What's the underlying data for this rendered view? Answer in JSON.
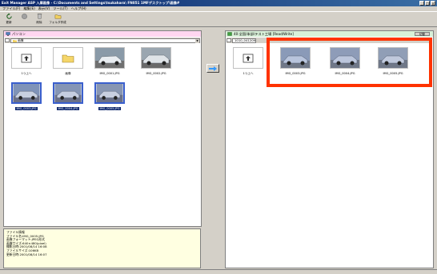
{
  "window": {
    "title": "Exit Manager ASP  入庫画像 - C:\\Documents and Settings\\tsukahara\\ FN051 1MFデスクトップ\\画像#",
    "controls": [
      "_",
      "□",
      "×"
    ]
  },
  "menu": [
    "ファイル(F)",
    "編集(E)",
    "表示(V)",
    "ツール(T)",
    "ヘルプ(H)"
  ],
  "toolbar": [
    {
      "label": "更新",
      "icon": "refresh-icon"
    },
    {
      "label": "",
      "icon": "stop-icon"
    },
    {
      "label": "削除",
      "icon": "delete-icon"
    },
    {
      "label": "フォルダ作成",
      "icon": "new-folder-icon"
    }
  ],
  "left_pane": {
    "header": "パソコン",
    "path": "画像",
    "items": [
      {
        "caption": "1つ上へ",
        "type": "up"
      },
      {
        "caption": "画像",
        "type": "folder"
      },
      {
        "caption": "IMG_0001.JPG",
        "type": "photo"
      },
      {
        "caption": "IMG_0002.JPG",
        "type": "photo"
      },
      {
        "caption": "IMG_0003.JPG",
        "type": "photo",
        "selected": true
      },
      {
        "caption": "IMG_0004.JPG",
        "type": "photo",
        "selected": true
      },
      {
        "caption": "IMG_0005.JPG",
        "type": "photo",
        "selected": true
      }
    ]
  },
  "right_pane": {
    "header": "40:全国/本部/テスト工場 [Read/Write]",
    "switch_label": "切替",
    "path": "1010_041209",
    "items": [
      {
        "caption": "1つ上へ",
        "type": "up"
      },
      {
        "caption": "IMG_0003.JPG",
        "type": "photo"
      },
      {
        "caption": "IMG_0004.JPG",
        "type": "photo"
      },
      {
        "caption": "IMG_0005.JPG",
        "type": "photo"
      }
    ]
  },
  "info": {
    "lines": [
      "ファイル情報",
      "ファイル名:IMG_0005.JPG",
      "画像フォーマット:JPEG形式",
      "画像サイズ:640×480(pixel)",
      "撮影日時:2001/08/14 16:08",
      "ファイルサイズ:106KB",
      "更新日時:2001/08/14 16:07"
    ]
  },
  "colors": {
    "title_start": "#0a246a",
    "title_end": "#3a6ea5",
    "left_header_bg": "#ffd6f0",
    "right_header_bg": "#d8f0d8",
    "info_bg": "#ffffe1",
    "highlight": "#ff3300",
    "arrow": "#3399ff"
  }
}
